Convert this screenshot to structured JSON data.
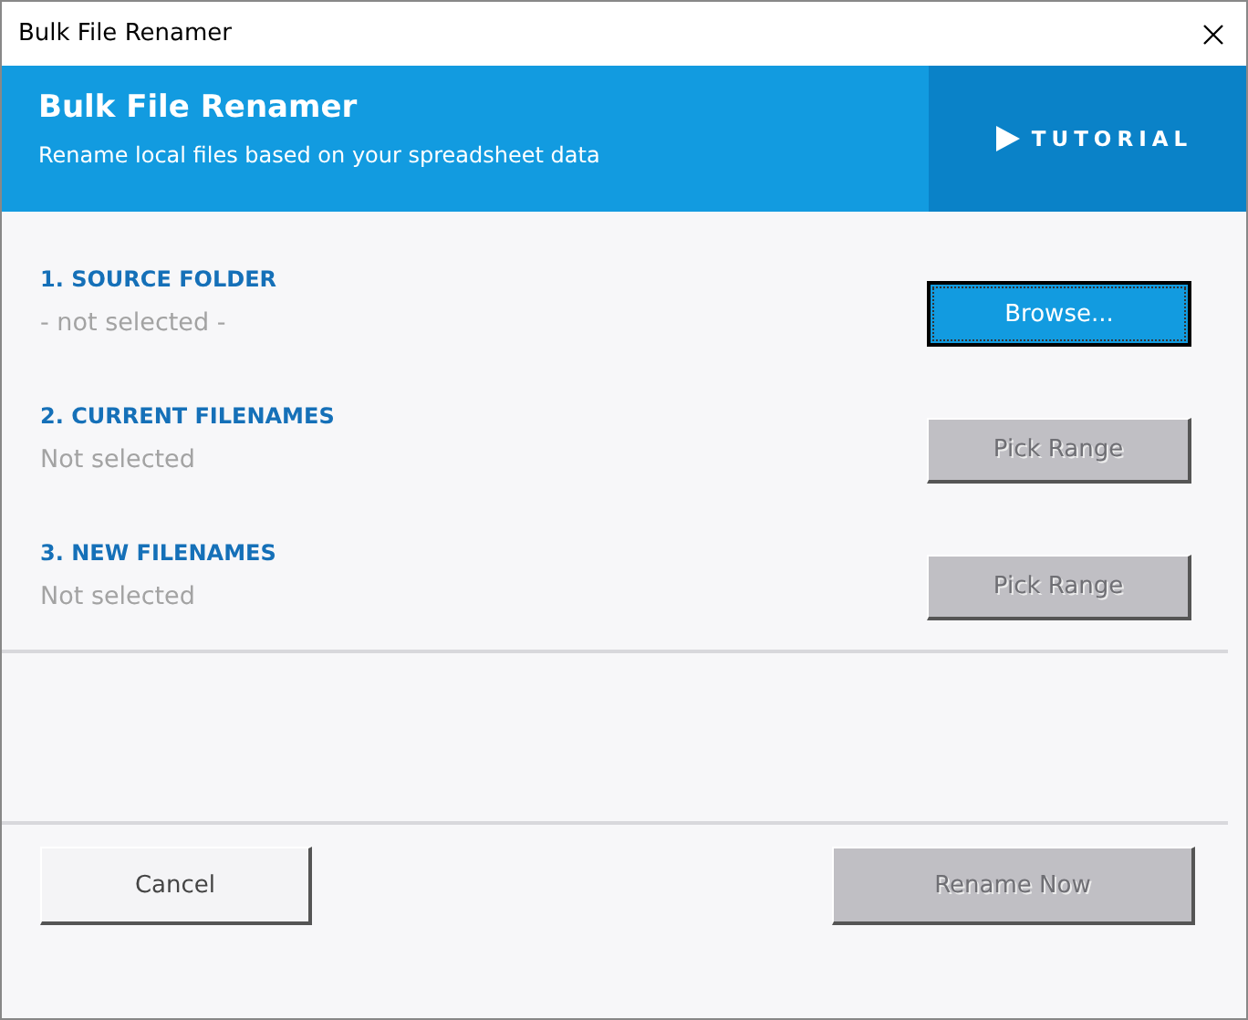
{
  "window": {
    "title": "Bulk File Renamer"
  },
  "header": {
    "title": "Bulk File Renamer",
    "subtitle": "Rename local files based on your spreadsheet data",
    "tutorial": {
      "label": "TUTORIAL"
    }
  },
  "sections": [
    {
      "heading": "1. SOURCE FOLDER",
      "value": "- not selected -",
      "button": {
        "label": "Browse...",
        "disabled": false,
        "focused": true
      }
    },
    {
      "heading": "2. CURRENT FILENAMES",
      "value": "Not selected",
      "button": {
        "label": "Pick Range",
        "disabled": true,
        "focused": false
      }
    },
    {
      "heading": "3. NEW FILENAMES",
      "value": "Not selected",
      "button": {
        "label": "Pick Range",
        "disabled": true,
        "focused": false
      }
    }
  ],
  "footer": [
    {
      "label": "Cancel",
      "disabled": false
    },
    {
      "label": "Rename Now",
      "disabled": true
    }
  ]
}
